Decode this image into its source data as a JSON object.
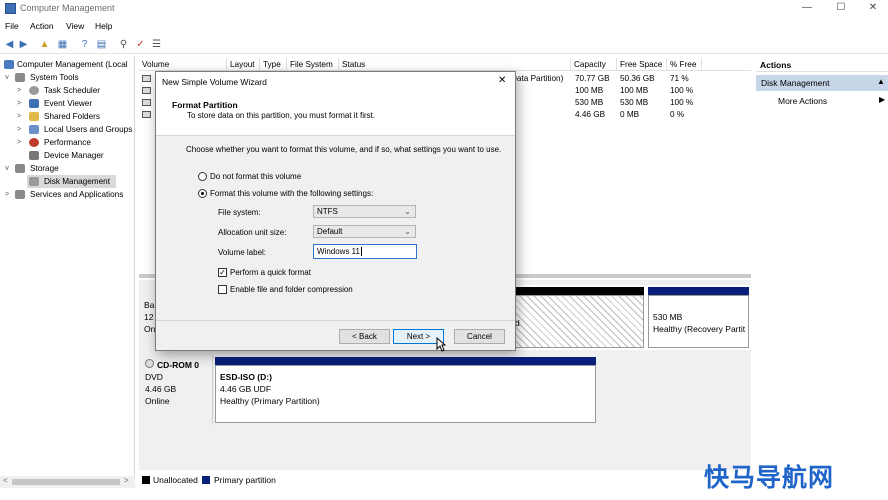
{
  "window": {
    "title": "Computer Management",
    "minimize": "—",
    "maximize": "☐",
    "close": "✕"
  },
  "menu": [
    "File",
    "Action",
    "View",
    "Help"
  ],
  "tree": {
    "root": "Computer Management (Local",
    "system_tools": "System Tools",
    "items": [
      "Task Scheduler",
      "Event Viewer",
      "Shared Folders",
      "Local Users and Groups",
      "Performance",
      "Device Manager"
    ],
    "storage": "Storage",
    "disk_management": "Disk Management",
    "services": "Services and Applications"
  },
  "list": {
    "columns": [
      "Volume",
      "Layout",
      "Type",
      "File System",
      "Status",
      "Capacity",
      "Free Space",
      "% Free"
    ],
    "status_visible": "Data Partition)",
    "rows": [
      {
        "capacity": "70.77 GB",
        "free": "50.36 GB",
        "pct": "71 %"
      },
      {
        "capacity": "100 MB",
        "free": "100 MB",
        "pct": "100 %"
      },
      {
        "capacity": "530 MB",
        "free": "530 MB",
        "pct": "100 %"
      },
      {
        "capacity": "4.46 GB",
        "free": "0 MB",
        "pct": "0 %"
      }
    ]
  },
  "disk0": {
    "name_partial": "Ba",
    "size_partial": "12",
    "state_partial": "On",
    "recovery_size": "530 MB",
    "recovery_status": "Healthy (Recovery Partit",
    "hidden_part_suffix": "d"
  },
  "cdrom": {
    "name": "CD-ROM 0",
    "type": "DVD",
    "size": "4.46 GB",
    "state": "Online",
    "volume_name": "ESD-ISO  (D:)",
    "volume_size": "4.46 GB UDF",
    "volume_status": "Healthy (Primary Partition)"
  },
  "legend": {
    "unallocated": "Unallocated",
    "primary": "Primary partition"
  },
  "actions": {
    "title": "Actions",
    "section": "Disk Management",
    "more": "More Actions"
  },
  "dialog": {
    "title": "New Simple Volume Wizard",
    "heading": "Format Partition",
    "subheading": "To store data on this partition, you must format it first.",
    "instruction": "Choose whether you want to format this volume, and if so, what settings you want to use.",
    "option_no_format": "Do not format this volume",
    "option_format": "Format this volume with the following settings:",
    "file_system_label": "File system:",
    "file_system_value": "NTFS",
    "alloc_label": "Allocation unit size:",
    "alloc_value": "Default",
    "volume_label_label": "Volume label:",
    "volume_label_value": "Windows 11",
    "quick_format": "Perform a quick format",
    "compression": "Enable file and folder compression",
    "back": "< Back",
    "next": "Next >",
    "cancel": "Cancel",
    "close": "✕"
  },
  "watermark": "快马导航网",
  "colors": {
    "primary_partition": "#0a1f7c",
    "unallocated": "#000000",
    "accent": "#0078d7"
  }
}
